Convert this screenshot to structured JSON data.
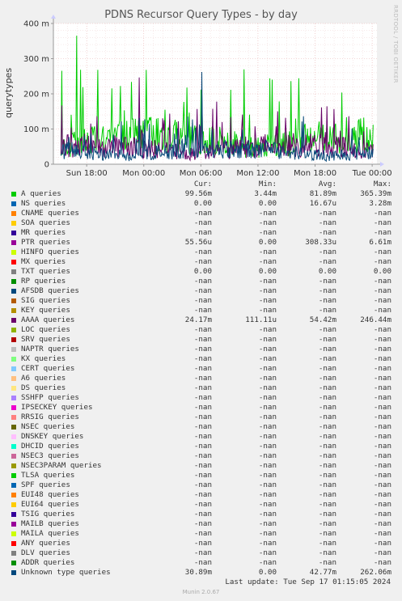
{
  "title": "PDNS Recursor Query Types - by day",
  "side_note": "RRDTOOL / TOBI OETIKER",
  "footer": {
    "last_update": "Last update: Tue Sep 17 01:15:05 2024",
    "munin": "Munin 2.0.67"
  },
  "legend_headers": {
    "cur": "Cur:",
    "min": "Min:",
    "avg": "Avg:",
    "max": "Max:"
  },
  "chart_data": {
    "type": "line",
    "ylabel": "querytypes",
    "ylim": [
      0,
      0.4
    ],
    "yticks": [
      {
        "v": 0,
        "label": "0"
      },
      {
        "v": 0.1,
        "label": "100 m"
      },
      {
        "v": 0.2,
        "label": "200 m"
      },
      {
        "v": 0.3,
        "label": "300 m"
      },
      {
        "v": 0.4,
        "label": "400 m"
      }
    ],
    "xrange_hours": [
      -3.5,
      30.5
    ],
    "xticks": [
      {
        "h": 0,
        "label": "Sun 18:00"
      },
      {
        "h": 6,
        "label": "Mon 00:00"
      },
      {
        "h": 12,
        "label": "Mon 06:00"
      },
      {
        "h": 18,
        "label": "Mon 12:00"
      },
      {
        "h": 24,
        "label": "Mon 18:00"
      },
      {
        "h": 30,
        "label": "Tue 00:00"
      }
    ],
    "grid": true,
    "series": [
      {
        "name": "A queries",
        "color": "#00cc00",
        "max": 0.36539,
        "avg": 0.08189,
        "plotted": true
      },
      {
        "name": "AAAA queries",
        "color": "#660066",
        "max": 0.24644,
        "avg": 0.05442,
        "plotted": true
      },
      {
        "name": "Unknown type queries",
        "color": "#0a4a7a",
        "max": 0.262,
        "avg": 0.04277,
        "plotted": true
      }
    ]
  },
  "legend": [
    {
      "name": "A queries",
      "color": "#00cc00",
      "cur": "99.56m",
      "min": "3.44m",
      "avg": "81.89m",
      "max": "365.39m"
    },
    {
      "name": "NS queries",
      "color": "#0066b3",
      "cur": "0.00",
      "min": "0.00",
      "avg": "16.67u",
      "max": "3.28m"
    },
    {
      "name": "CNAME queries",
      "color": "#ff8000",
      "cur": "-nan",
      "min": "-nan",
      "avg": "-nan",
      "max": "-nan"
    },
    {
      "name": "SOA queries",
      "color": "#ffcc00",
      "cur": "-nan",
      "min": "-nan",
      "avg": "-nan",
      "max": "-nan"
    },
    {
      "name": "MR queries",
      "color": "#330099",
      "cur": "-nan",
      "min": "-nan",
      "avg": "-nan",
      "max": "-nan"
    },
    {
      "name": "PTR queries",
      "color": "#990099",
      "cur": "55.56u",
      "min": "0.00",
      "avg": "308.33u",
      "max": "6.61m"
    },
    {
      "name": "HINFO queries",
      "color": "#ccff00",
      "cur": "-nan",
      "min": "-nan",
      "avg": "-nan",
      "max": "-nan"
    },
    {
      "name": "MX queries",
      "color": "#ff0000",
      "cur": "-nan",
      "min": "-nan",
      "avg": "-nan",
      "max": "-nan"
    },
    {
      "name": "TXT queries",
      "color": "#808080",
      "cur": "0.00",
      "min": "0.00",
      "avg": "0.00",
      "max": "0.00"
    },
    {
      "name": "RP queries",
      "color": "#008f00",
      "cur": "-nan",
      "min": "-nan",
      "avg": "-nan",
      "max": "-nan"
    },
    {
      "name": "AFSDB queries",
      "color": "#00487d",
      "cur": "-nan",
      "min": "-nan",
      "avg": "-nan",
      "max": "-nan"
    },
    {
      "name": "SIG queries",
      "color": "#b35a00",
      "cur": "-nan",
      "min": "-nan",
      "avg": "-nan",
      "max": "-nan"
    },
    {
      "name": "KEY queries",
      "color": "#b38f00",
      "cur": "-nan",
      "min": "-nan",
      "avg": "-nan",
      "max": "-nan"
    },
    {
      "name": "AAAA queries",
      "color": "#6b006b",
      "cur": "24.17m",
      "min": "111.11u",
      "avg": "54.42m",
      "max": "246.44m"
    },
    {
      "name": "LOC queries",
      "color": "#8fb300",
      "cur": "-nan",
      "min": "-nan",
      "avg": "-nan",
      "max": "-nan"
    },
    {
      "name": "SRV queries",
      "color": "#b30000",
      "cur": "-nan",
      "min": "-nan",
      "avg": "-nan",
      "max": "-nan"
    },
    {
      "name": "NAPTR queries",
      "color": "#bebebe",
      "cur": "-nan",
      "min": "-nan",
      "avg": "-nan",
      "max": "-nan"
    },
    {
      "name": "KX queries",
      "color": "#80ff80",
      "cur": "-nan",
      "min": "-nan",
      "avg": "-nan",
      "max": "-nan"
    },
    {
      "name": "CERT queries",
      "color": "#80c9ff",
      "cur": "-nan",
      "min": "-nan",
      "avg": "-nan",
      "max": "-nan"
    },
    {
      "name": "A6 queries",
      "color": "#ffc080",
      "cur": "-nan",
      "min": "-nan",
      "avg": "-nan",
      "max": "-nan"
    },
    {
      "name": "DS queries",
      "color": "#ffe680",
      "cur": "-nan",
      "min": "-nan",
      "avg": "-nan",
      "max": "-nan"
    },
    {
      "name": "SSHFP queries",
      "color": "#aa80ff",
      "cur": "-nan",
      "min": "-nan",
      "avg": "-nan",
      "max": "-nan"
    },
    {
      "name": "IPSECKEY queries",
      "color": "#ee00cc",
      "cur": "-nan",
      "min": "-nan",
      "avg": "-nan",
      "max": "-nan"
    },
    {
      "name": "RRSIG queries",
      "color": "#ff8080",
      "cur": "-nan",
      "min": "-nan",
      "avg": "-nan",
      "max": "-nan"
    },
    {
      "name": "NSEC queries",
      "color": "#666600",
      "cur": "-nan",
      "min": "-nan",
      "avg": "-nan",
      "max": "-nan"
    },
    {
      "name": "DNSKEY queries",
      "color": "#ffbfff",
      "cur": "-nan",
      "min": "-nan",
      "avg": "-nan",
      "max": "-nan"
    },
    {
      "name": "DHCID queries",
      "color": "#00ffcc",
      "cur": "-nan",
      "min": "-nan",
      "avg": "-nan",
      "max": "-nan"
    },
    {
      "name": "NSEC3 queries",
      "color": "#cc6699",
      "cur": "-nan",
      "min": "-nan",
      "avg": "-nan",
      "max": "-nan"
    },
    {
      "name": "NSEC3PARAM queries",
      "color": "#999900",
      "cur": "-nan",
      "min": "-nan",
      "avg": "-nan",
      "max": "-nan"
    },
    {
      "name": "TLSA queries",
      "color": "#00cc00",
      "cur": "-nan",
      "min": "-nan",
      "avg": "-nan",
      "max": "-nan"
    },
    {
      "name": "SPF queries",
      "color": "#0066b3",
      "cur": "-nan",
      "min": "-nan",
      "avg": "-nan",
      "max": "-nan"
    },
    {
      "name": "EUI48 queries",
      "color": "#ff8000",
      "cur": "-nan",
      "min": "-nan",
      "avg": "-nan",
      "max": "-nan"
    },
    {
      "name": "EUI64 queries",
      "color": "#ffcc00",
      "cur": "-nan",
      "min": "-nan",
      "avg": "-nan",
      "max": "-nan"
    },
    {
      "name": "TSIG queries",
      "color": "#330099",
      "cur": "-nan",
      "min": "-nan",
      "avg": "-nan",
      "max": "-nan"
    },
    {
      "name": "MAILB queries",
      "color": "#990099",
      "cur": "-nan",
      "min": "-nan",
      "avg": "-nan",
      "max": "-nan"
    },
    {
      "name": "MAILA queries",
      "color": "#ccff00",
      "cur": "-nan",
      "min": "-nan",
      "avg": "-nan",
      "max": "-nan"
    },
    {
      "name": "ANY queries",
      "color": "#ff0000",
      "cur": "-nan",
      "min": "-nan",
      "avg": "-nan",
      "max": "-nan"
    },
    {
      "name": "DLV queries",
      "color": "#808080",
      "cur": "-nan",
      "min": "-nan",
      "avg": "-nan",
      "max": "-nan"
    },
    {
      "name": "ADDR queries",
      "color": "#008f00",
      "cur": "-nan",
      "min": "-nan",
      "avg": "-nan",
      "max": "-nan"
    },
    {
      "name": "Unknown type queries",
      "color": "#00487d",
      "cur": "30.89m",
      "min": "0.00",
      "avg": "42.77m",
      "max": "262.06m"
    }
  ]
}
